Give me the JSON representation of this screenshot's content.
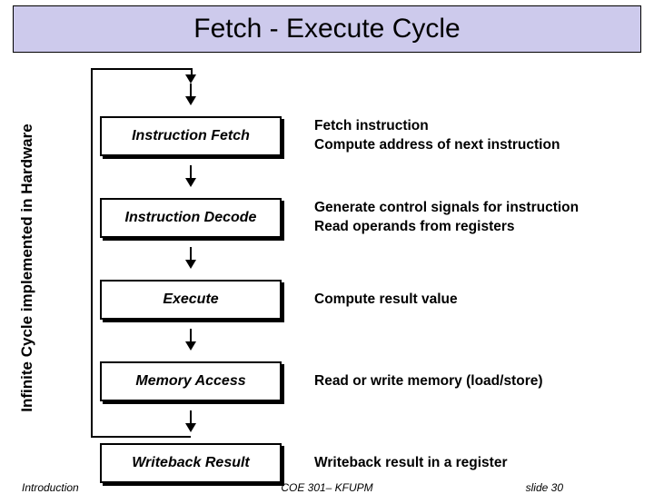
{
  "title": "Fetch - Execute Cycle",
  "sidebar_label": "Infinite Cycle implemented in Hardware",
  "stages": [
    {
      "name": "Instruction Fetch",
      "desc": "Fetch instruction\nCompute address of next instruction"
    },
    {
      "name": "Instruction Decode",
      "desc": "Generate control signals for instruction\nRead operands from registers"
    },
    {
      "name": "Execute",
      "desc": "Compute result value"
    },
    {
      "name": "Memory Access",
      "desc": "Read or write memory (load/store)"
    },
    {
      "name": "Writeback Result",
      "desc": "Writeback result in a register"
    }
  ],
  "footer": {
    "left": "Introduction",
    "center": "COE 301– KFUPM",
    "right": "slide 30"
  }
}
